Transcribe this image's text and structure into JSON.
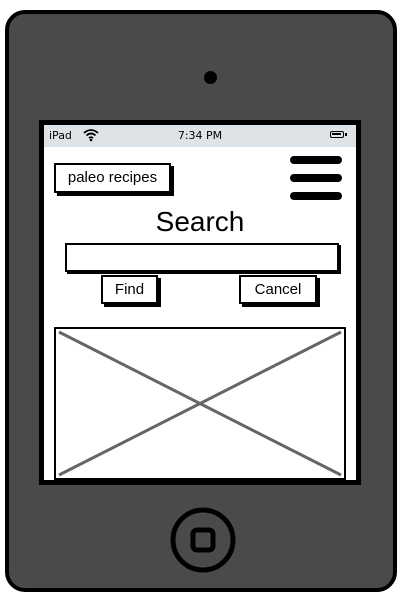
{
  "status_bar": {
    "carrier": "iPad",
    "time": "7:34 PM",
    "wifi_icon": "wifi-icon",
    "battery_icon": "battery-icon"
  },
  "header": {
    "tag_label": "paleo recipes",
    "menu_icon": "hamburger-menu-icon"
  },
  "search": {
    "title": "Search",
    "input_value": "",
    "placeholder": "",
    "find_label": "Find",
    "cancel_label": "Cancel"
  },
  "content": {
    "image_placeholder_icon": "image-placeholder-icon"
  },
  "device": {
    "frame_color": "#4a4a4a",
    "status_bar_color": "#dde3e6"
  }
}
